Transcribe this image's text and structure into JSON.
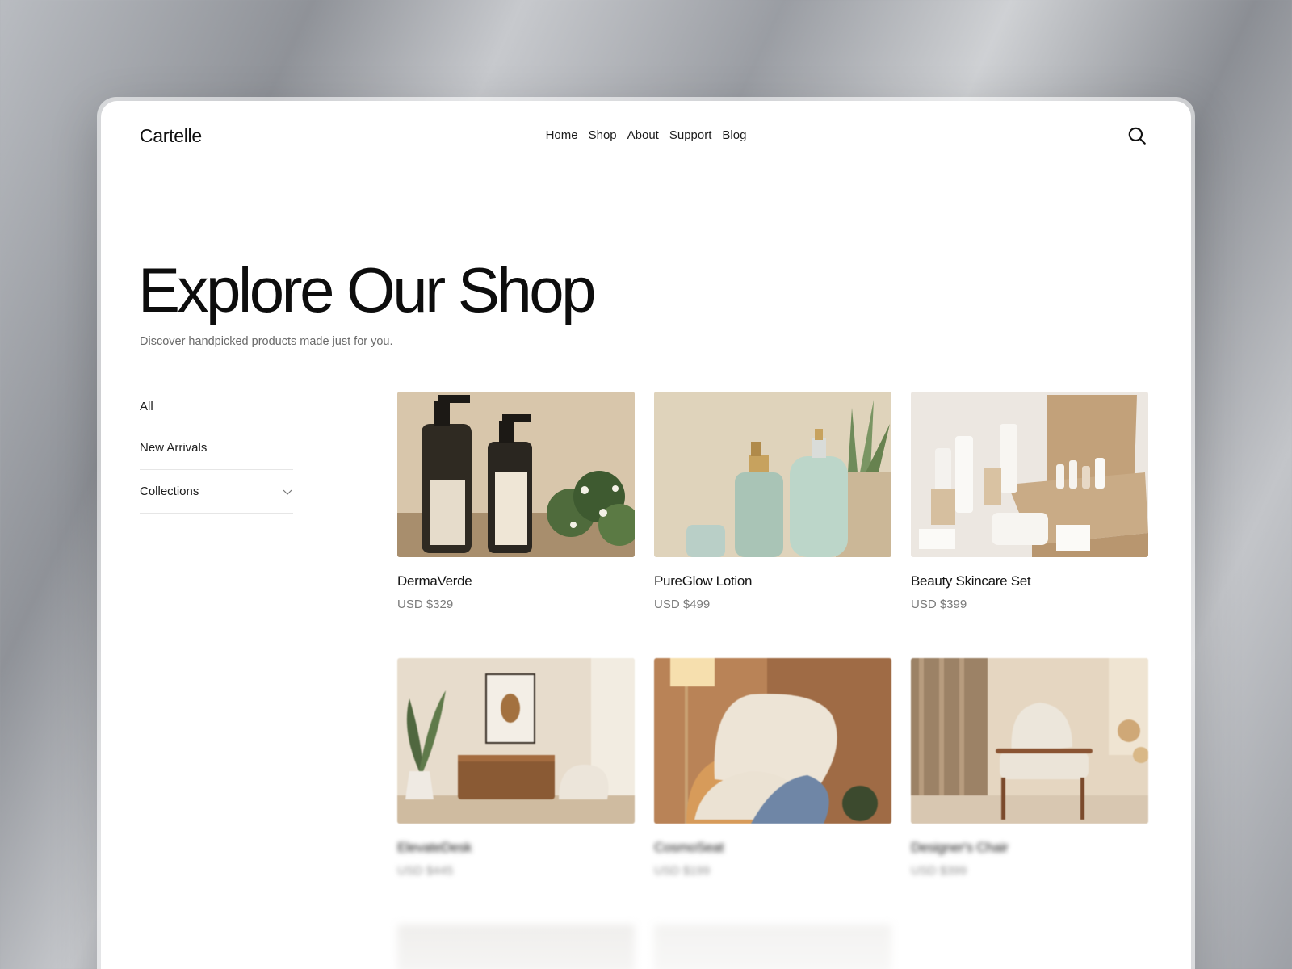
{
  "brand": "Cartelle",
  "nav": [
    "Home",
    "Shop",
    "About",
    "Support",
    "Blog"
  ],
  "hero": {
    "title": "Explore Our Shop",
    "subtitle": "Discover handpicked products made just for you."
  },
  "sidebar": {
    "items": [
      {
        "label": "All"
      },
      {
        "label": "New Arrivals"
      },
      {
        "label": "Collections",
        "icon": "chevron-down-icon"
      }
    ]
  },
  "products": [
    {
      "name": "DermaVerde",
      "price": "USD $329"
    },
    {
      "name": "PureGlow Lotion",
      "price": "USD $499"
    },
    {
      "name": "Beauty Skincare Set",
      "price": "USD $399"
    },
    {
      "name": "ElevateDesk",
      "price": "USD $445"
    },
    {
      "name": "CosmoSeat",
      "price": "USD $199"
    },
    {
      "name": "Designer's Chair",
      "price": "USD $399"
    }
  ],
  "colors": {
    "accent": "#111111",
    "muted": "#7a7a7a"
  }
}
